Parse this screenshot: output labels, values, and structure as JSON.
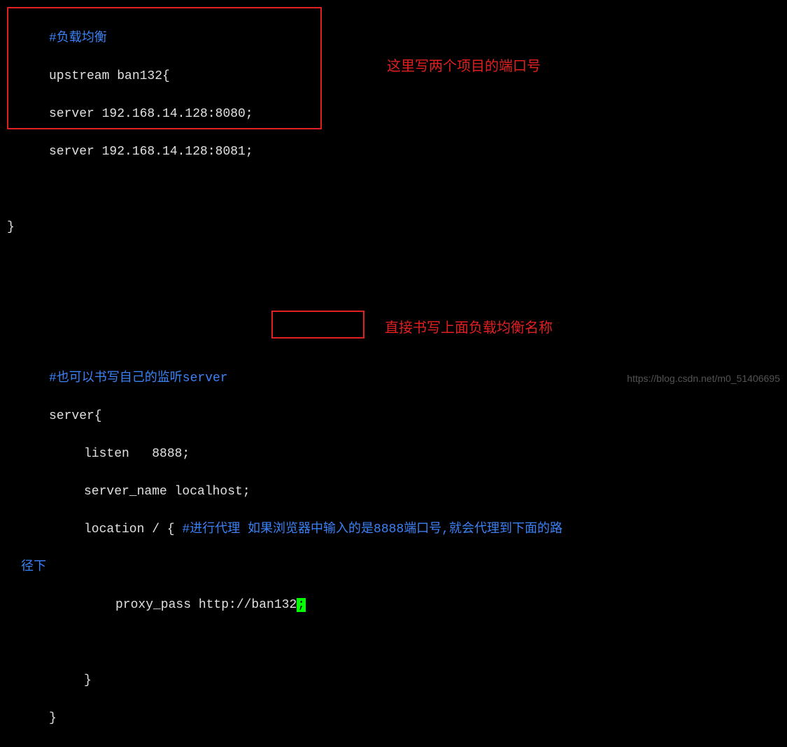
{
  "code": {
    "comment_upstream": "#负载均衡",
    "upstream_decl": "upstream ban132{",
    "server1": "server 192.168.14.128:8080;",
    "server2": "server 192.168.14.128:8081;",
    "close_brace1": "}",
    "comment_server": "#也可以书写自己的监听server",
    "server_decl": "server{",
    "listen": "listen   8888;",
    "server_name": "server_name localhost;",
    "location_start": "location / { ",
    "location_comment": "#进行代理 如果浏览器中输入的是8888端口号,就会代理到下面的路",
    "location_wrap": "径下",
    "proxy_pass": "proxy_pass http://ban132",
    "cursor": ";",
    "close_brace2": "}",
    "close_brace3": "}"
  },
  "annotations": {
    "anno1": "这里写两个项目的端口号",
    "anno2": "直接书写上面负载均衡名称"
  },
  "watermark": "https://blog.csdn.net/m0_51406695"
}
